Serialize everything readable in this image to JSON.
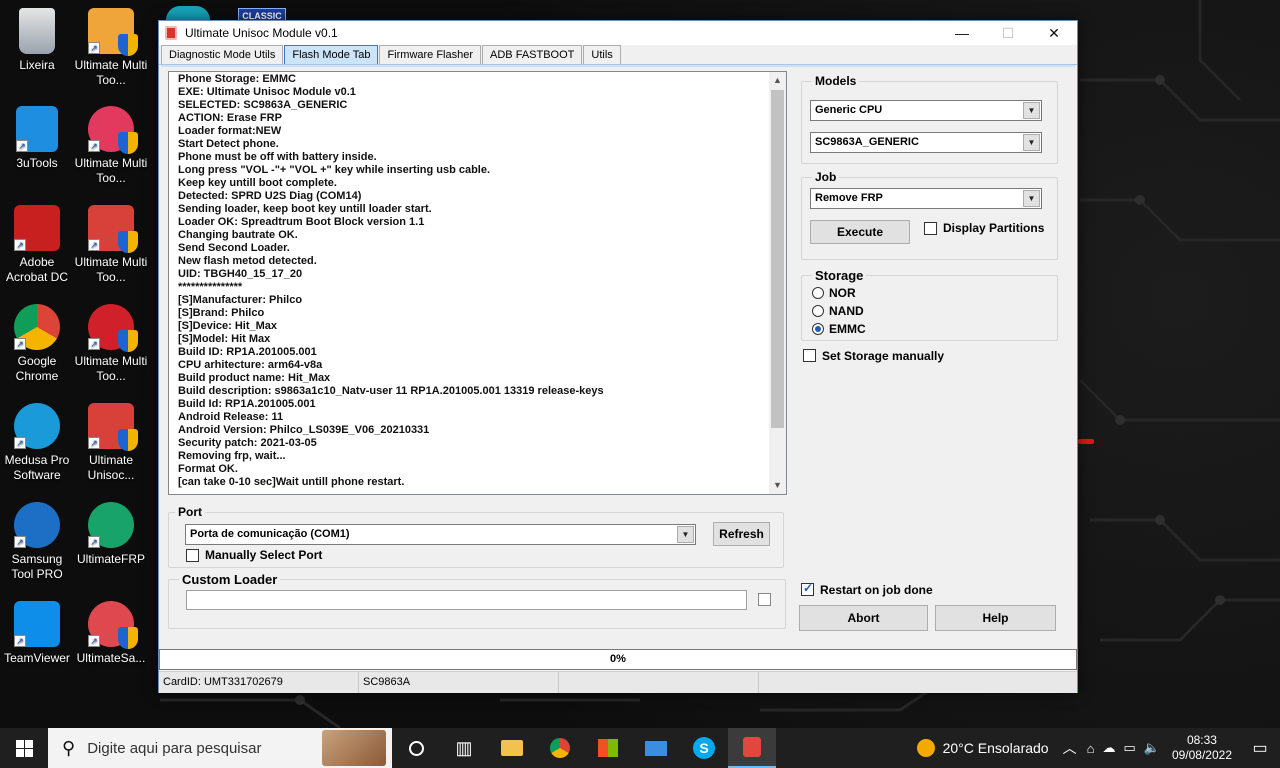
{
  "desktop": {
    "icons": [
      {
        "label": "Lixeira"
      },
      {
        "label": "Ultimate Multi Too..."
      },
      {
        "label": "3uTools"
      },
      {
        "label": "Ultimate Multi Too..."
      },
      {
        "label": "Adobe Acrobat DC"
      },
      {
        "label": "Ultimate Multi Too..."
      },
      {
        "label": "Google Chrome"
      },
      {
        "label": "Ultimate Multi Too..."
      },
      {
        "label": "Medusa Pro Software"
      },
      {
        "label": "Ultimate Unisoc..."
      },
      {
        "label": "Samsung Tool PRO"
      },
      {
        "label": "UltimateFRP"
      },
      {
        "label": "TeamViewer"
      },
      {
        "label": "UltimateSa..."
      }
    ],
    "partial_icon_label": "CLASSIC"
  },
  "window": {
    "title": "Ultimate Unisoc Module v0.1",
    "tabs": [
      {
        "label": "Diagnostic  Mode Utils"
      },
      {
        "label": "Flash Mode Tab"
      },
      {
        "label": "Firmware Flasher"
      },
      {
        "label": "ADB FASTBOOT"
      },
      {
        "label": "Utils"
      }
    ],
    "log": [
      "Phone Storage: EMMC",
      "EXE: Ultimate Unisoc Module v0.1",
      "SELECTED: SC9863A_GENERIC",
      "ACTION: Erase FRP",
      "Loader format:NEW",
      "Start Detect phone.",
      "Phone must be off with battery inside.",
      "Long press \"VOL -\"+ \"VOL +\" key while inserting usb cable.",
      "Keep key untill boot complete.",
      "Detected: SPRD U2S Diag (COM14)",
      "Sending loader, keep boot key untill loader start.",
      "Loader OK: Spreadtrum Boot Block version 1.1",
      "Changing bautrate OK.",
      "Send Second Loader.",
      "New flash metod detected.",
      "UID: TBGH40_15_17_20",
      "***************",
      "[S]Manufacturer: Philco",
      "[S]Brand: Philco",
      "[S]Device: Hit_Max",
      "[S]Model: Hit Max",
      "Build ID: RP1A.201005.001",
      "CPU arhitecture: arm64-v8a",
      "Build product name: Hit_Max",
      "Build description: s9863a1c10_Natv-user 11 RP1A.201005.001 13319 release-keys",
      "Build Id: RP1A.201005.001",
      "Android Release: 11",
      "Android Version: Philco_LS039E_V06_20210331",
      "Security patch: 2021-03-05",
      "Removing frp, wait...",
      "Format OK.",
      "[can take 0-10 sec]Wait untill phone restart."
    ],
    "models": {
      "label": "Models",
      "cpu": "Generic CPU",
      "model": "SC9863A_GENERIC"
    },
    "job": {
      "label": "Job",
      "selected": "Remove FRP",
      "execute": "Execute",
      "display_partitions": "Display Partitions"
    },
    "storage": {
      "label": "Storage",
      "options": [
        "NOR",
        "NAND",
        "EMMC"
      ],
      "selected": "EMMC",
      "manual": "Set Storage manually"
    },
    "port": {
      "label": "Port",
      "selected": "Porta de comunicação (COM1)",
      "refresh": "Refresh",
      "manual": "Manually Select Port"
    },
    "custom_loader": {
      "label": "Custom Loader",
      "value": ""
    },
    "restart_on_done": {
      "label": "Restart on job done",
      "checked": true
    },
    "abort": "Abort",
    "help": "Help",
    "progress": {
      "text": "0%",
      "value": 0
    },
    "status": {
      "card_id": "CardID: UMT331702679",
      "chip": "SC9863A"
    }
  },
  "taskbar": {
    "search_placeholder": "Digite aqui para pesquisar",
    "weather": "20°C  Ensolarado",
    "time": "08:33",
    "date": "09/08/2022"
  }
}
